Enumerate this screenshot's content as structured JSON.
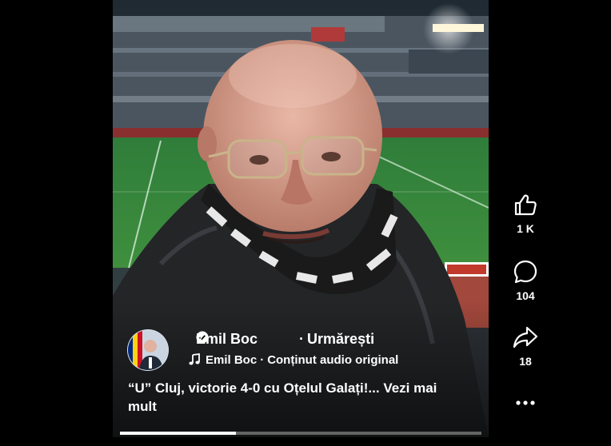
{
  "author": {
    "name": "Emil Boc",
    "follow_label": "Urmărești",
    "separator": "·"
  },
  "audio": {
    "artist": "Emil Boc",
    "label": "Conținut audio original",
    "separator": "·"
  },
  "caption": {
    "text": "“U” Cluj, victorie 4-0 cu Oțelul Galați!...",
    "more_label": "Vezi mai mult"
  },
  "actions": {
    "like_count": "1 K",
    "comment_count": "104",
    "share_count": "18"
  },
  "video": {
    "progress": 0.32
  },
  "colors": {
    "background": "#000000",
    "text": "#ffffff",
    "verified": "#ffffff"
  }
}
